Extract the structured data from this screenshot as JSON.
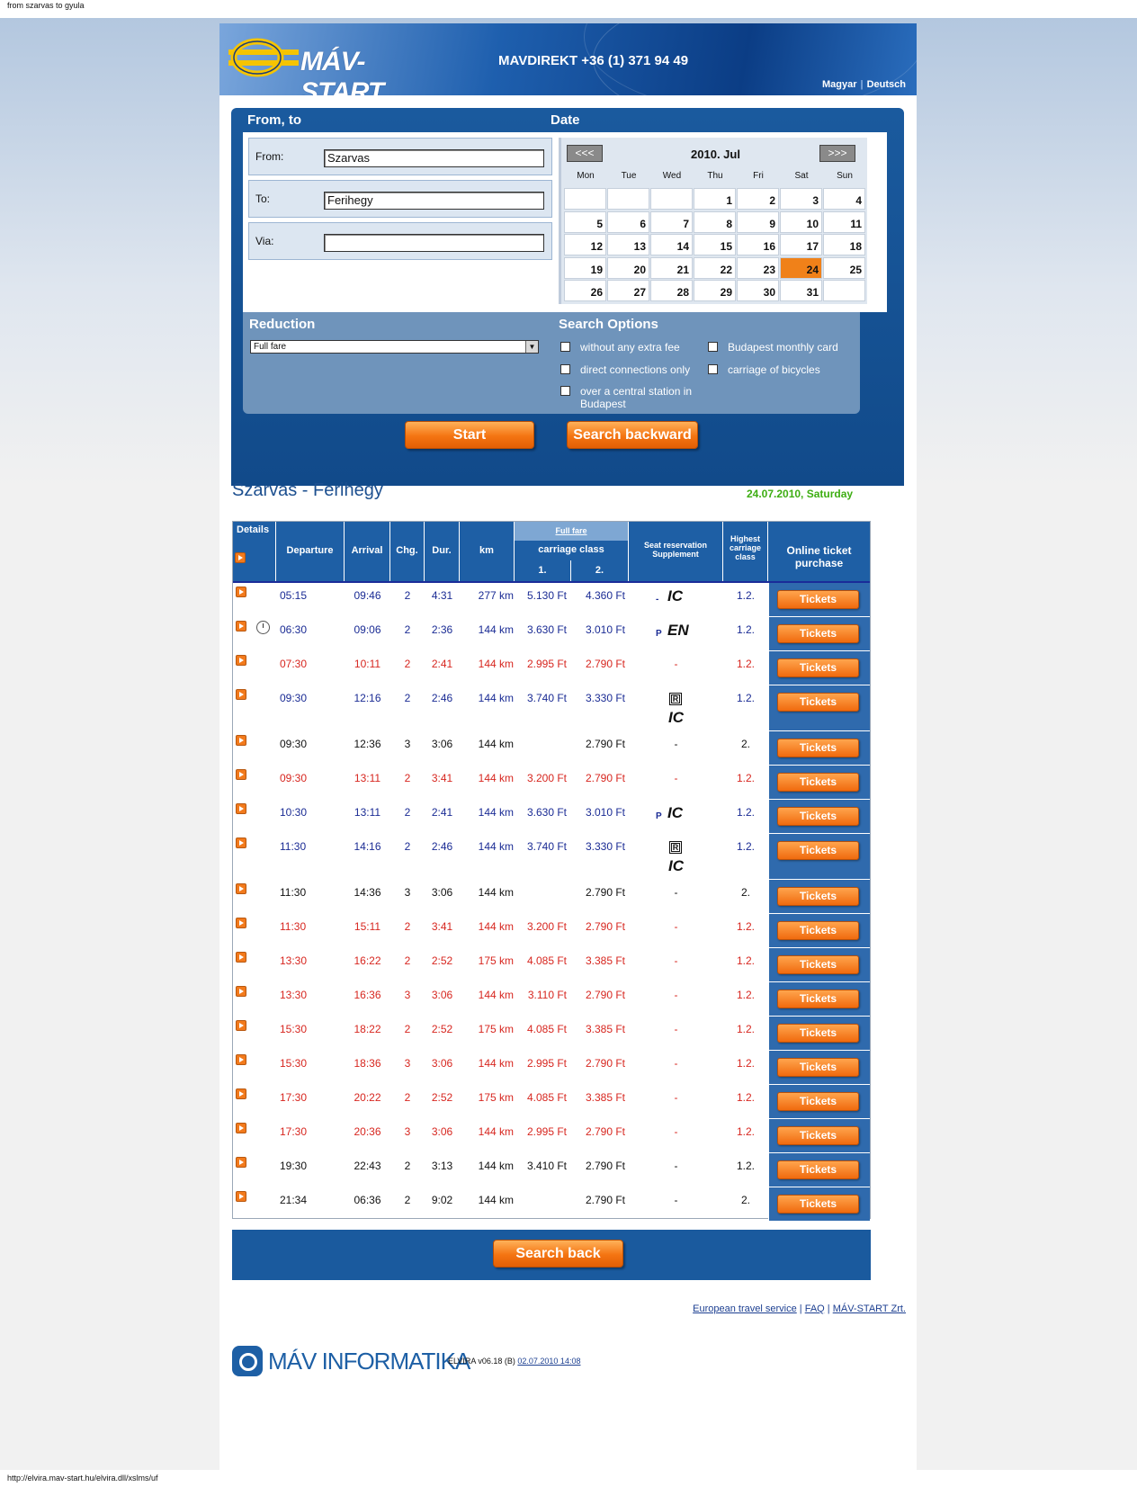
{
  "window": {
    "title": "from szarvas to gyula",
    "status_url": "http://elvira.mav-start.hu/elvira.dll/xslms/uf"
  },
  "header": {
    "logo_text": "MÁV-START",
    "phone": "MAVDIREKT +36 (1) 371 94 49",
    "lang_hu": "Magyar",
    "lang_de": "Deutsch"
  },
  "form": {
    "from_to_title": "From, to",
    "date_title": "Date",
    "from_label": "From:",
    "from_value": "Szarvas",
    "to_label": "To:",
    "to_value": "Ferihegy",
    "via_label": "Via:",
    "via_value": "",
    "calendar": {
      "prev": "<<<",
      "next": ">>>",
      "month": "2010. Jul",
      "weekdays": [
        "Mon",
        "Tue",
        "Wed",
        "Thu",
        "Fri",
        "Sat",
        "Sun"
      ],
      "days": [
        "",
        "",
        "",
        "1",
        "2",
        "3",
        "4",
        "5",
        "6",
        "7",
        "8",
        "9",
        "10",
        "11",
        "12",
        "13",
        "14",
        "15",
        "16",
        "17",
        "18",
        "19",
        "20",
        "21",
        "22",
        "23",
        "24",
        "25",
        "26",
        "27",
        "28",
        "29",
        "30",
        "31",
        ""
      ],
      "selected": "24",
      "selected_color": "#f08119"
    },
    "reduction_title": "Reduction",
    "reduction_value": "Full fare",
    "options_title": "Search Options",
    "options": [
      "without any extra fee",
      "Budapest monthly card",
      "direct connections only",
      "carriage of bicycles",
      "over a central station in Budapest"
    ],
    "start_button": "Start",
    "search_backward_button": "Search backward"
  },
  "results": {
    "route": "Szarvas - Ferihegy",
    "date": "24.07.2010, Saturday",
    "headers": {
      "details": "Details",
      "departure": "Departure",
      "arrival": "Arrival",
      "chg": "Chg.",
      "dur": "Dur.",
      "km": "km",
      "full_fare": "Full fare",
      "carriage_class": "carriage class",
      "class1": "1.",
      "class2": "2.",
      "seat": "Seat reservation Supplement",
      "highest": "Highest carriage class",
      "online": "Online ticket purchase"
    },
    "ticket_label": "Tickets",
    "rows": [
      {
        "dep": "05:15",
        "arr": "09:46",
        "chg": "2",
        "dur": "4:31",
        "km": "277 km",
        "f1": "5.130 Ft",
        "f2": "4.360 Ft",
        "seat": "- IC",
        "hcc": "1.2.",
        "color": "blue"
      },
      {
        "dep": "06:30",
        "arr": "09:06",
        "chg": "2",
        "dur": "2:36",
        "km": "144 km",
        "f1": "3.630 Ft",
        "f2": "3.010 Ft",
        "seat": "P EN",
        "hcc": "1.2.",
        "color": "blue",
        "clock": true
      },
      {
        "dep": "07:30",
        "arr": "10:11",
        "chg": "2",
        "dur": "2:41",
        "km": "144 km",
        "f1": "2.995 Ft",
        "f2": "2.790 Ft",
        "seat": "-",
        "hcc": "1.2.",
        "color": "red"
      },
      {
        "dep": "09:30",
        "arr": "12:16",
        "chg": "2",
        "dur": "2:46",
        "km": "144 km",
        "f1": "3.740 Ft",
        "f2": "3.330 Ft",
        "seat": "R IC",
        "hcc": "1.2.",
        "color": "blue",
        "tall": true
      },
      {
        "dep": "09:30",
        "arr": "12:36",
        "chg": "3",
        "dur": "3:06",
        "km": "144 km",
        "f1": "",
        "f2": "2.790 Ft",
        "seat": "-",
        "hcc": "2.",
        "color": "black"
      },
      {
        "dep": "09:30",
        "arr": "13:11",
        "chg": "2",
        "dur": "3:41",
        "km": "144 km",
        "f1": "3.200 Ft",
        "f2": "2.790 Ft",
        "seat": "-",
        "hcc": "1.2.",
        "color": "red"
      },
      {
        "dep": "10:30",
        "arr": "13:11",
        "chg": "2",
        "dur": "2:41",
        "km": "144 km",
        "f1": "3.630 Ft",
        "f2": "3.010 Ft",
        "seat": "P IC",
        "hcc": "1.2.",
        "color": "blue"
      },
      {
        "dep": "11:30",
        "arr": "14:16",
        "chg": "2",
        "dur": "2:46",
        "km": "144 km",
        "f1": "3.740 Ft",
        "f2": "3.330 Ft",
        "seat": "R IC",
        "hcc": "1.2.",
        "color": "blue",
        "tall": true
      },
      {
        "dep": "11:30",
        "arr": "14:36",
        "chg": "3",
        "dur": "3:06",
        "km": "144 km",
        "f1": "",
        "f2": "2.790 Ft",
        "seat": "-",
        "hcc": "2.",
        "color": "black"
      },
      {
        "dep": "11:30",
        "arr": "15:11",
        "chg": "2",
        "dur": "3:41",
        "km": "144 km",
        "f1": "3.200 Ft",
        "f2": "2.790 Ft",
        "seat": "-",
        "hcc": "1.2.",
        "color": "red"
      },
      {
        "dep": "13:30",
        "arr": "16:22",
        "chg": "2",
        "dur": "2:52",
        "km": "175 km",
        "f1": "4.085 Ft",
        "f2": "3.385 Ft",
        "seat": "-",
        "hcc": "1.2.",
        "color": "red"
      },
      {
        "dep": "13:30",
        "arr": "16:36",
        "chg": "3",
        "dur": "3:06",
        "km": "144 km",
        "f1": "3.110 Ft",
        "f2": "2.790 Ft",
        "seat": "-",
        "hcc": "1.2.",
        "color": "red"
      },
      {
        "dep": "15:30",
        "arr": "18:22",
        "chg": "2",
        "dur": "2:52",
        "km": "175 km",
        "f1": "4.085 Ft",
        "f2": "3.385 Ft",
        "seat": "-",
        "hcc": "1.2.",
        "color": "red"
      },
      {
        "dep": "15:30",
        "arr": "18:36",
        "chg": "3",
        "dur": "3:06",
        "km": "144 km",
        "f1": "2.995 Ft",
        "f2": "2.790 Ft",
        "seat": "-",
        "hcc": "1.2.",
        "color": "red"
      },
      {
        "dep": "17:30",
        "arr": "20:22",
        "chg": "2",
        "dur": "2:52",
        "km": "175 km",
        "f1": "4.085 Ft",
        "f2": "3.385 Ft",
        "seat": "-",
        "hcc": "1.2.",
        "color": "red"
      },
      {
        "dep": "17:30",
        "arr": "20:36",
        "chg": "3",
        "dur": "3:06",
        "km": "144 km",
        "f1": "2.995 Ft",
        "f2": "2.790 Ft",
        "seat": "-",
        "hcc": "1.2.",
        "color": "red"
      },
      {
        "dep": "19:30",
        "arr": "22:43",
        "chg": "2",
        "dur": "3:13",
        "km": "144 km",
        "f1": "3.410 Ft",
        "f2": "2.790 Ft",
        "seat": "-",
        "hcc": "1.2.",
        "color": "black"
      },
      {
        "dep": "21:34",
        "arr": "06:36",
        "chg": "2",
        "dur": "9:02",
        "km": "144 km",
        "f1": "",
        "f2": "2.790 Ft",
        "seat": "-",
        "hcc": "2.",
        "color": "black"
      }
    ],
    "search_back_button": "Search back"
  },
  "footer": {
    "links": [
      "European travel service",
      "FAQ",
      "MÁV-START Zrt."
    ],
    "brand": "MÁV INFORMATIKA",
    "version": "ELVIRA v06.18 (B)",
    "version_date": "02.07.2010 14:08"
  },
  "colors": {
    "accent_orange": "#f27a1c",
    "header_blue": "#1a5a9e",
    "route_blue": "#1c4f8f",
    "date_green": "#3dad12",
    "red_row": "#d7261f",
    "blue_row": "#1a2b94"
  }
}
